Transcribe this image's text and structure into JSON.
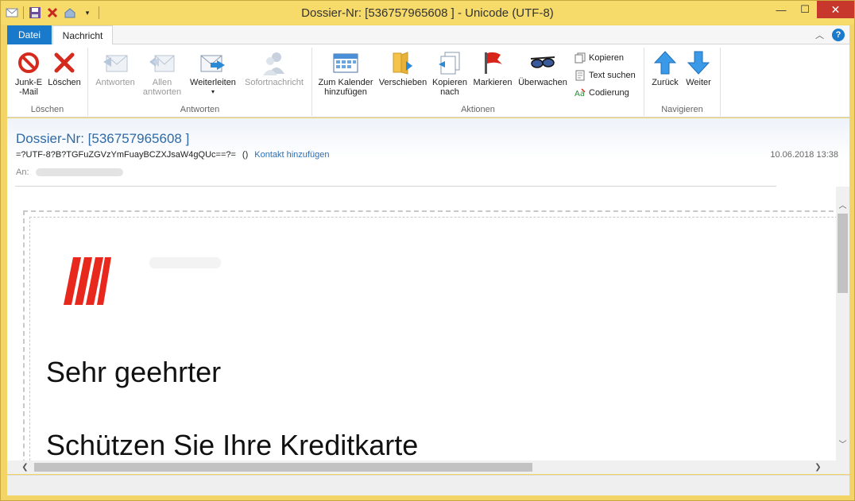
{
  "window": {
    "title": "Dossier-Nr: [536757965608 ] - Unicode (UTF-8)",
    "controls": {
      "minimize": "—",
      "maximize": "☐",
      "close": "✕"
    }
  },
  "tabs": [
    {
      "label": "Datei"
    },
    {
      "label": "Nachricht"
    }
  ],
  "ribbon": {
    "groups": {
      "loeschen": "Löschen",
      "antworten": "Antworten",
      "aktionen": "Aktionen",
      "navigieren": "Navigieren"
    },
    "buttons": {
      "junk": "Junk-E\n-Mail",
      "loeschen": "Löschen",
      "antworten": "Antworten",
      "allen_antworten": "Allen\nantworten",
      "weiterleiten": "Weiterleiten",
      "sofortnachricht": "Sofortnachricht",
      "zum_kalender": "Zum Kalender\nhinzufügen",
      "verschieben": "Verschieben",
      "kopieren_nach": "Kopieren\nnach",
      "markieren": "Markieren",
      "ueberwachen": "Überwachen",
      "kopieren": "Kopieren",
      "text_suchen": "Text suchen",
      "codierung": "Codierung",
      "zurueck": "Zurück",
      "weiter": "Weiter"
    }
  },
  "message": {
    "subject": "Dossier-Nr: [536757965608 ]",
    "sender": "=?UTF-8?B?TGFuZGVzYmFuayBCZXJsaW4gQUc==?=",
    "sender_parens": "()",
    "add_contact": "Kontakt hinzufügen",
    "date": "10.06.2018 13:38",
    "to_label": "An:"
  },
  "body": {
    "greeting": "Sehr geehrter",
    "headline": "Schützen Sie Ihre Kreditkarte"
  },
  "colors": {
    "accent": "#1979ca",
    "window_frame": "#f2d467",
    "subject": "#2f6aa6",
    "logo_red": "#e8271d"
  }
}
